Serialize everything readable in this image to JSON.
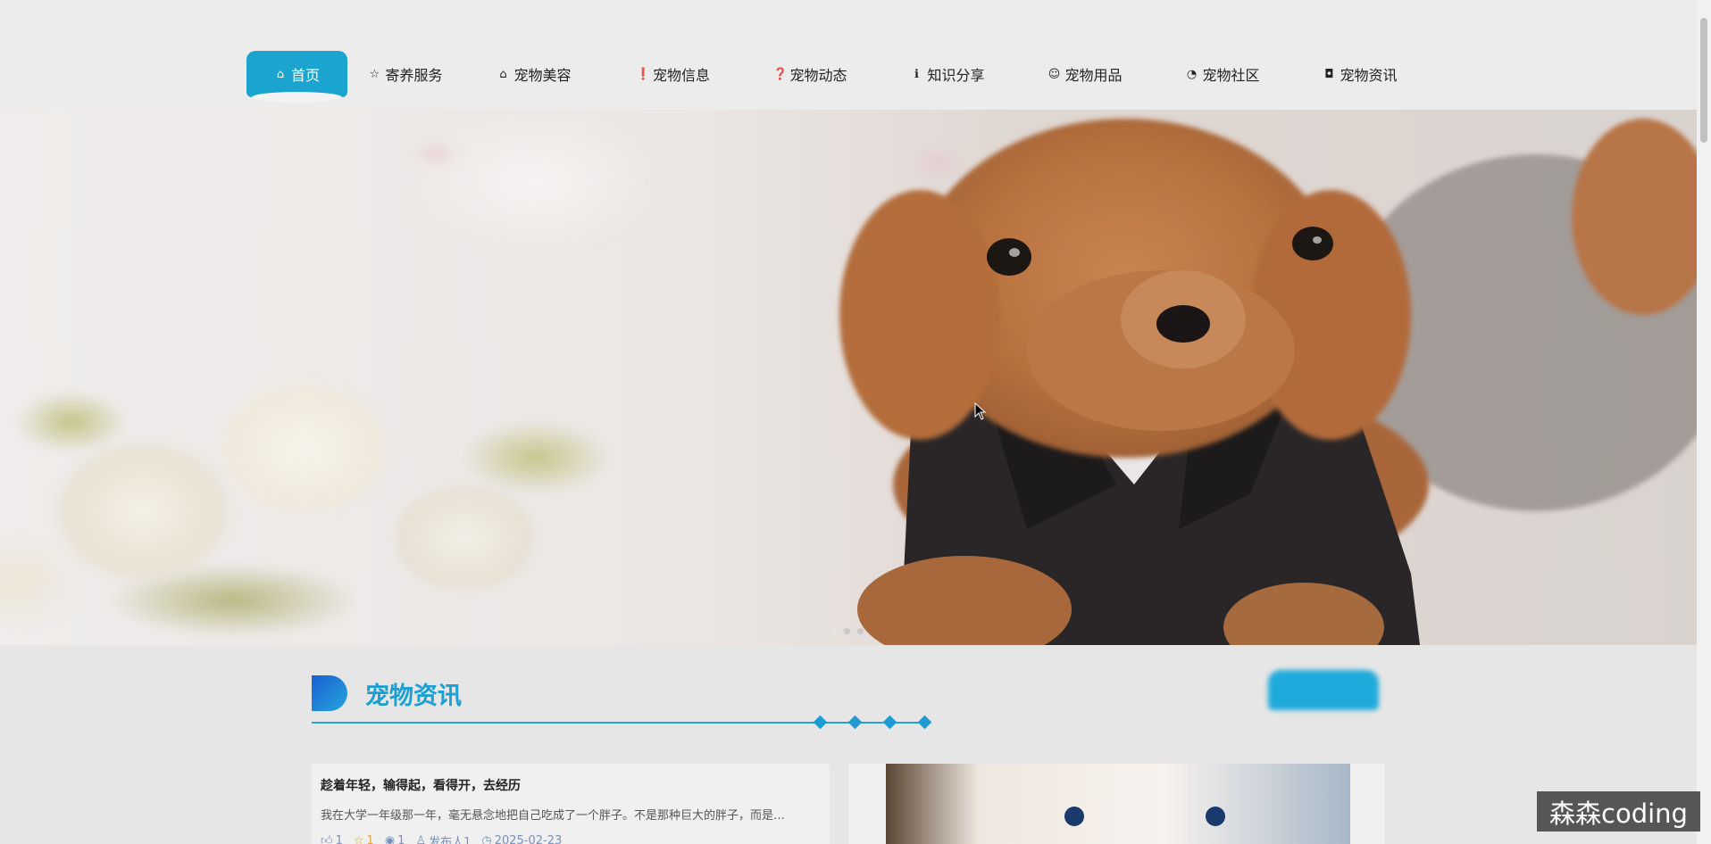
{
  "nav": {
    "items": [
      {
        "label": "首页",
        "icon": "home-icon",
        "glyph": "⌂"
      },
      {
        "label": "寄养服务",
        "icon": "star-icon",
        "glyph": "☆"
      },
      {
        "label": "宠物美容",
        "icon": "bag-icon",
        "glyph": "⌂"
      },
      {
        "label": "宠物信息",
        "icon": "alert-icon",
        "glyph": "❗"
      },
      {
        "label": "宠物动态",
        "icon": "question-icon",
        "glyph": "❓"
      },
      {
        "label": "知识分享",
        "icon": "info-icon",
        "glyph": "ℹ"
      },
      {
        "label": "宠物用品",
        "icon": "smile-icon",
        "glyph": "☺"
      },
      {
        "label": "宠物社区",
        "icon": "clock-icon",
        "glyph": "◔"
      },
      {
        "label": "宠物资讯",
        "icon": "camera-icon",
        "glyph": "◘"
      }
    ],
    "active_index": 0
  },
  "hero": {
    "active_slide": 0,
    "slide_count": 3
  },
  "section": {
    "title": "宠物资讯",
    "more_label": ""
  },
  "news": [
    {
      "title": "趁着年轻，输得起，看得开，去经历",
      "desc": "我在大学一年级那一年，毫无悬念地把自己吃成了一个胖子。不是那种巨大的胖子，而是…",
      "likes": "1",
      "stars": "1",
      "views": "1",
      "author": "发布人1",
      "date": "2025-02-23"
    }
  ],
  "watermark": "森森coding",
  "colors": {
    "accent": "#1ba4cf",
    "title": "#1aa0d3",
    "bg": "#e6e6e6"
  }
}
